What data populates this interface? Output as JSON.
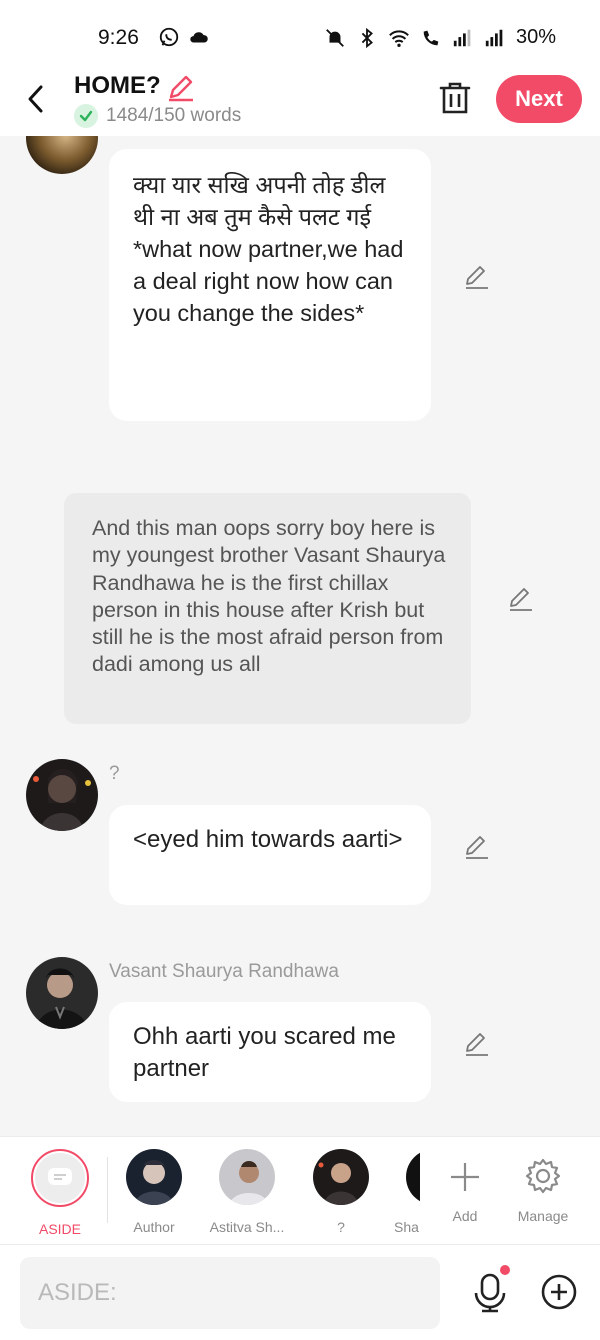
{
  "status_bar": {
    "time": "9:26",
    "battery": "30%"
  },
  "header": {
    "title": "HOME?",
    "word_count": "1484/150 words",
    "next_label": "Next"
  },
  "messages": [
    {
      "type": "character",
      "text": "क्या यार सखि अपनी तोह डील थी ना अब तुम कैसे पलट गई\n*what now partner,we had a deal right now how can you change the sides*"
    },
    {
      "type": "narration",
      "text": "And this man oops sorry boy here is my youngest brother Vasant Shaurya Randhawa he is the first chillax person in this house after Krish but still he is the most afraid person from dadi among us all"
    },
    {
      "type": "character",
      "sender": "?",
      "text": "<eyed him towards aarti>"
    },
    {
      "type": "character",
      "sender": "Vasant Shaurya Randhawa",
      "text": "Ohh aarti you scared me partner"
    }
  ],
  "characters": [
    {
      "label": "ASIDE",
      "active": true
    },
    {
      "label": "Author"
    },
    {
      "label": "Astitva Sh..."
    },
    {
      "label": "?"
    },
    {
      "label": "Sha"
    },
    {
      "label": "Add"
    },
    {
      "label": "Manage"
    }
  ],
  "input": {
    "placeholder": "ASIDE:"
  },
  "colors": {
    "accent": "#f14b67",
    "chat_bg": "#f5f5f5",
    "narration_bg": "#ebebeb"
  }
}
